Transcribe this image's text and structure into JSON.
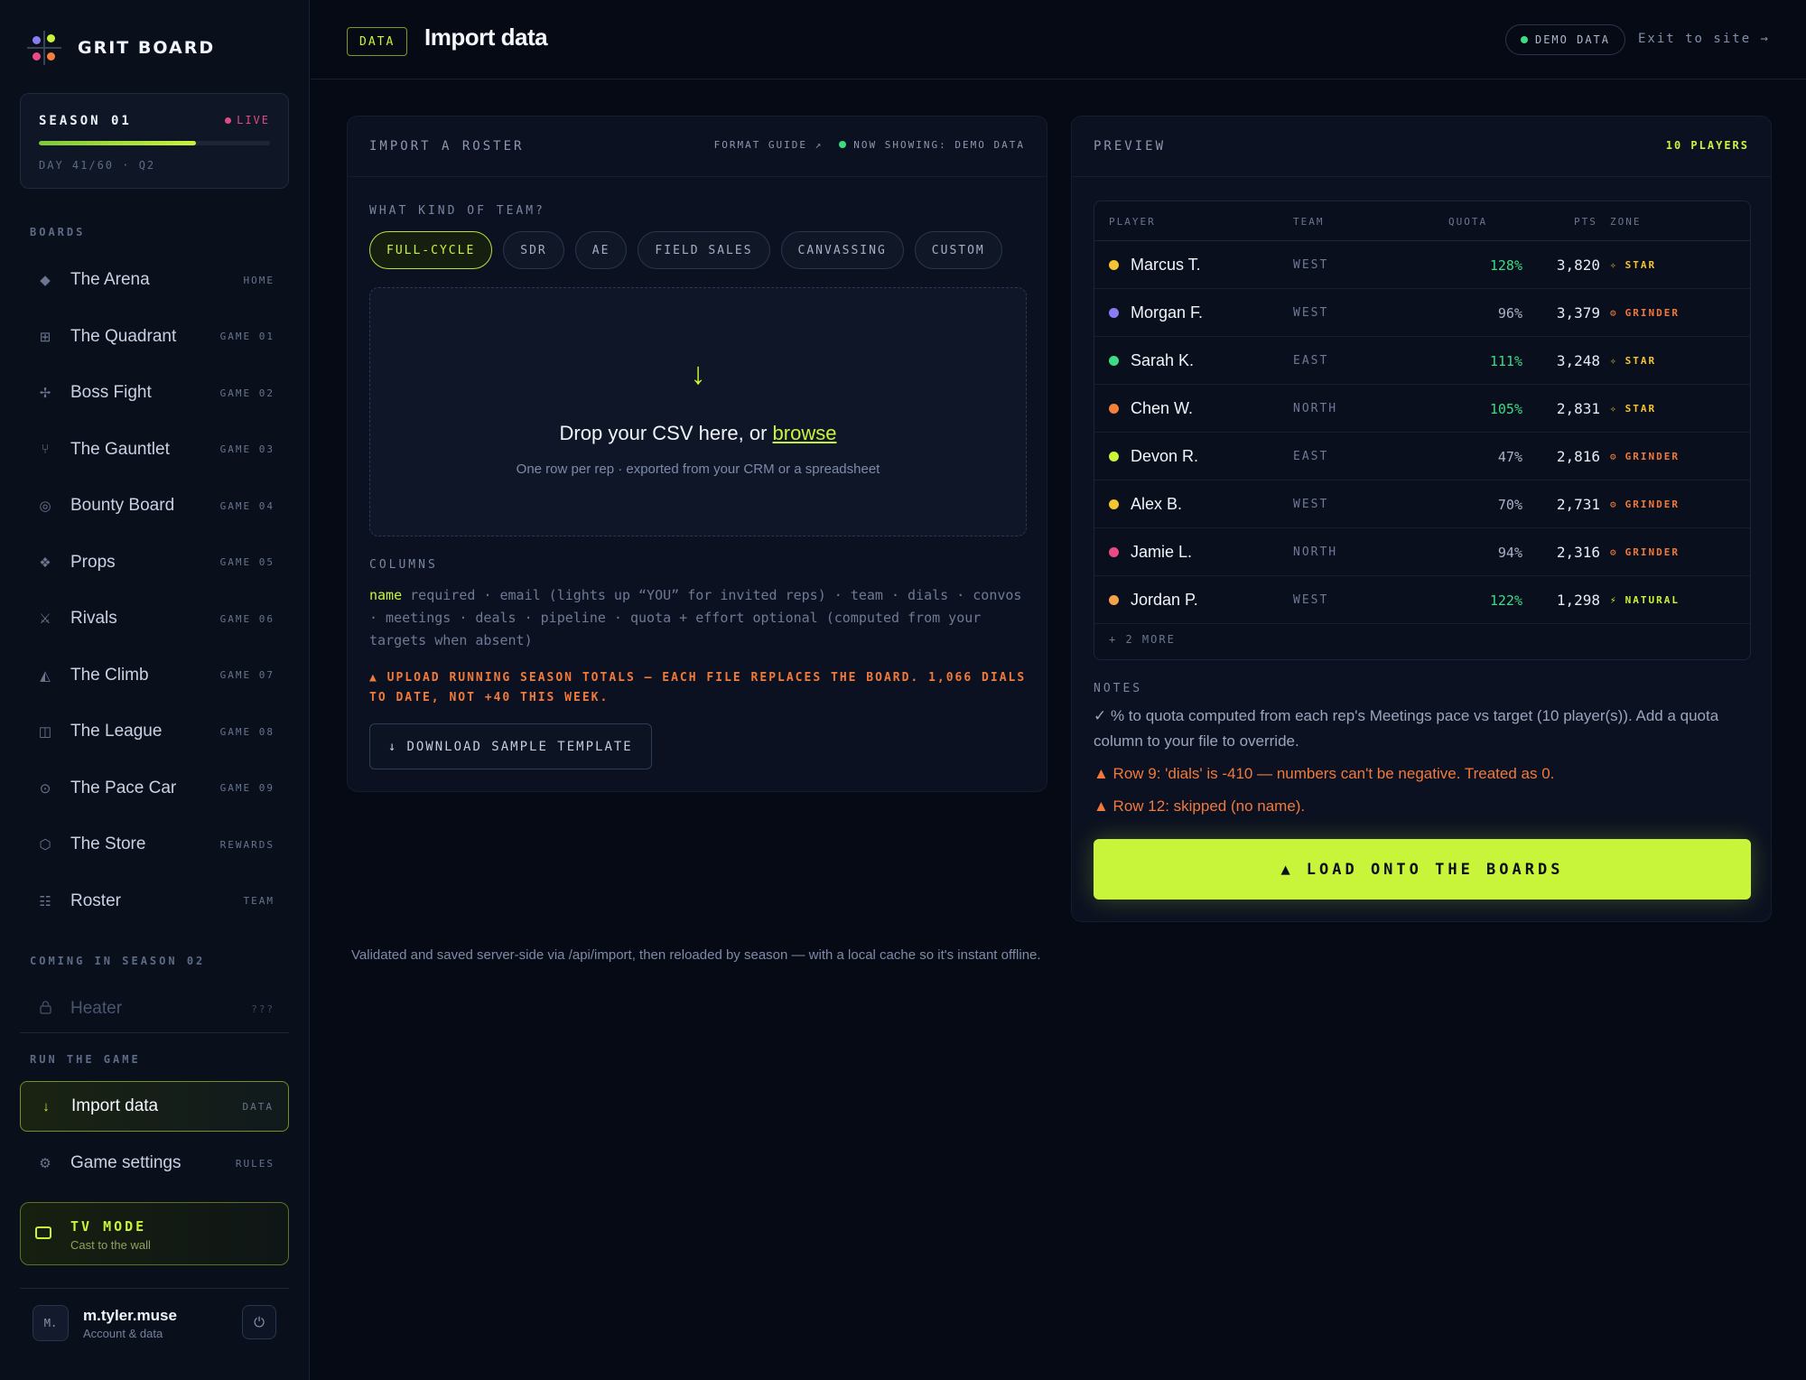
{
  "brand": {
    "name": "GRIT BOARD"
  },
  "season": {
    "title": "SEASON 01",
    "status": "LIVE",
    "progress": 0.68,
    "day": "DAY 41/60 · Q2"
  },
  "nav": {
    "boards_label": "BOARDS",
    "items": [
      {
        "icon": "◆",
        "icon_name": "diamond-icon",
        "label": "The Arena",
        "tag": "HOME"
      },
      {
        "icon": "⊞",
        "icon_name": "grid-icon",
        "label": "The Quadrant",
        "tag": "GAME 01"
      },
      {
        "icon": "✢",
        "icon_name": "crosshair-icon",
        "label": "Boss Fight",
        "tag": "GAME 02"
      },
      {
        "icon": "⑂",
        "icon_name": "fork-icon",
        "label": "The Gauntlet",
        "tag": "GAME 03"
      },
      {
        "icon": "◎",
        "icon_name": "target-icon",
        "label": "Bounty Board",
        "tag": "GAME 04"
      },
      {
        "icon": "❖",
        "icon_name": "props-icon",
        "label": "Props",
        "tag": "GAME 05"
      },
      {
        "icon": "⚔",
        "icon_name": "swords-icon",
        "label": "Rivals",
        "tag": "GAME 06"
      },
      {
        "icon": "◭",
        "icon_name": "mountain-icon",
        "label": "The Climb",
        "tag": "GAME 07"
      },
      {
        "icon": "◫",
        "icon_name": "league-icon",
        "label": "The League",
        "tag": "GAME 08"
      },
      {
        "icon": "⊙",
        "icon_name": "pace-icon",
        "label": "The Pace Car",
        "tag": "GAME 09"
      },
      {
        "icon": "⬡",
        "icon_name": "store-icon",
        "label": "The Store",
        "tag": "REWARDS"
      },
      {
        "icon": "☷",
        "icon_name": "roster-icon",
        "label": "Roster",
        "tag": "TEAM"
      }
    ],
    "coming_label": "COMING IN SEASON 02",
    "locked": {
      "icon": "🔒",
      "icon_name": "lock-icon",
      "label": "Heater",
      "tag": "???"
    },
    "run_label": "RUN THE GAME",
    "run_items": [
      {
        "icon": "↓",
        "icon_name": "download-icon",
        "label": "Import data",
        "tag": "DATA"
      },
      {
        "icon": "⚙",
        "icon_name": "gear-icon",
        "label": "Game settings",
        "tag": "RULES"
      }
    ]
  },
  "tv": {
    "title": "TV MODE",
    "sub": "Cast to the wall"
  },
  "user": {
    "initials": "M.",
    "name": "m.tyler.muse",
    "sub": "Account & data",
    "power_icon": "⏻"
  },
  "header": {
    "tag": "DATA",
    "title": "Import data",
    "demo_pill": "DEMO DATA",
    "exit": "Exit to site →"
  },
  "import": {
    "title": "IMPORT A ROSTER",
    "format_guide": "FORMAT GUIDE ↗",
    "now_showing": "NOW SHOWING: DEMO DATA",
    "team_question": "WHAT KIND OF TEAM?",
    "team_types": [
      "FULL-CYCLE",
      "SDR",
      "AE",
      "FIELD SALES",
      "CANVASSING",
      "CUSTOM"
    ],
    "selected_team": "FULL-CYCLE",
    "drop_arrow": "↓",
    "drop_text": "Drop your CSV here, or ",
    "drop_link": "browse",
    "drop_sub": "One row per rep · exported from your CRM or a spreadsheet",
    "columns_label": "COLUMNS",
    "columns_required": "name",
    "columns_text": " required · email (lights up “YOU” for invited reps) · team · dials · convos · meetings · deals · pipeline · quota + effort optional (computed from your targets when absent)",
    "warning": "▲ UPLOAD RUNNING SEASON TOTALS — EACH FILE REPLACES THE BOARD. 1,066 DIALS TO DATE, NOT +40 THIS WEEK.",
    "download_icon": "↓",
    "download_label": "DOWNLOAD SAMPLE TEMPLATE"
  },
  "preview": {
    "title": "PREVIEW",
    "count": "10 PLAYERS",
    "headers": {
      "player": "PLAYER",
      "team": "TEAM",
      "quota": "QUOTA",
      "pts": "PTS",
      "zone": "ZONE"
    },
    "rows": [
      {
        "name": "Marcus T.",
        "team": "WEST",
        "quota": "128%",
        "pts": "3,820",
        "zone": "STAR",
        "zone_icon": "✧",
        "dot": "#f5c431",
        "quota_color": "#3ddc84",
        "zone_color": "#f5c431"
      },
      {
        "name": "Morgan F.",
        "team": "WEST",
        "quota": "96%",
        "pts": "3,379",
        "zone": "GRINDER",
        "zone_icon": "⚙",
        "dot": "#8b7cf6",
        "quota_color": "#aab3c7",
        "zone_color": "#f07a3c"
      },
      {
        "name": "Sarah K.",
        "team": "EAST",
        "quota": "111%",
        "pts": "3,248",
        "zone": "STAR",
        "zone_icon": "✧",
        "dot": "#3ddc84",
        "quota_color": "#3ddc84",
        "zone_color": "#f5c431"
      },
      {
        "name": "Chen W.",
        "team": "NORTH",
        "quota": "105%",
        "pts": "2,831",
        "zone": "STAR",
        "zone_icon": "✧",
        "dot": "#f5803c",
        "quota_color": "#3ddc84",
        "zone_color": "#f5c431"
      },
      {
        "name": "Devon R.",
        "team": "EAST",
        "quota": "47%",
        "pts": "2,816",
        "zone": "GRINDER",
        "zone_icon": "⚙",
        "dot": "#c8f43a",
        "quota_color": "#aab3c7",
        "zone_color": "#f07a3c"
      },
      {
        "name": "Alex B.",
        "team": "WEST",
        "quota": "70%",
        "pts": "2,731",
        "zone": "GRINDER",
        "zone_icon": "⚙",
        "dot": "#f5c431",
        "quota_color": "#aab3c7",
        "zone_color": "#f07a3c"
      },
      {
        "name": "Jamie L.",
        "team": "NORTH",
        "quota": "94%",
        "pts": "2,316",
        "zone": "GRINDER",
        "zone_icon": "⚙",
        "dot": "#ec4a86",
        "quota_color": "#aab3c7",
        "zone_color": "#f07a3c"
      },
      {
        "name": "Jordan P.",
        "team": "WEST",
        "quota": "122%",
        "pts": "1,298",
        "zone": "NATURAL",
        "zone_icon": "⚡",
        "dot": "#f5a04a",
        "quota_color": "#3ddc84",
        "zone_color": "#c8f43a"
      }
    ],
    "more": "+ 2 MORE",
    "notes_label": "NOTES",
    "note_ok": "✓ % to quota computed from each rep's Meetings pace vs target (10 player(s)). Add a quota column to your file to override.",
    "note_warn_1": "▲ Row 9: 'dials' is -410 — numbers can't be negative. Treated as 0.",
    "note_warn_2": "▲ Row 12: skipped (no name).",
    "load_icon": "▲",
    "load_label": "LOAD ONTO THE BOARDS"
  },
  "footer": "Validated and saved server-side via /api/import, then reloaded by season — with a local cache so it's instant offline.",
  "colors": {
    "accent": "#c8f43a",
    "live": "#e24a86",
    "warn": "#f07a3c",
    "good": "#3ddc84"
  }
}
